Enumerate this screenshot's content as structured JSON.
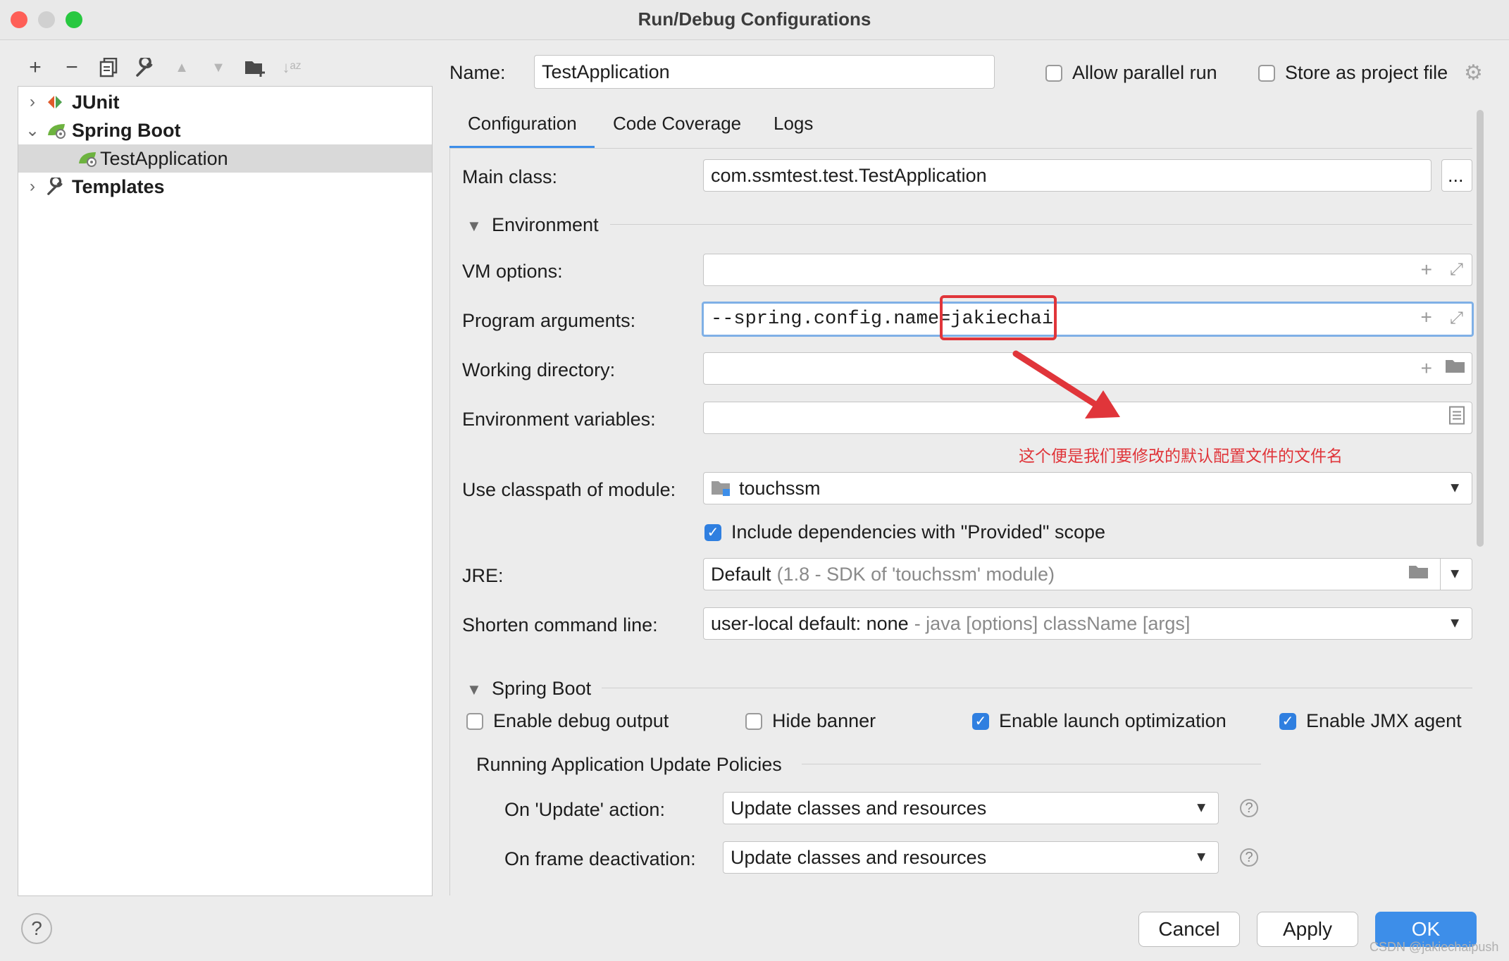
{
  "window": {
    "title": "Run/Debug Configurations"
  },
  "toolbar": {
    "icons": [
      "plus-icon",
      "minus-icon",
      "copy-icon",
      "wrench-icon",
      "arrow-up-icon",
      "arrow-down-icon",
      "new-folder-icon",
      "sort-icon"
    ]
  },
  "tree": {
    "items": [
      {
        "label": "JUnit"
      },
      {
        "label": "Spring Boot"
      },
      {
        "label": "TestApplication"
      },
      {
        "label": "Templates"
      }
    ]
  },
  "header": {
    "name_label": "Name:",
    "name_value": "TestApplication",
    "allow_parallel_label": "Allow parallel run",
    "store_as_project_label": "Store as project file"
  },
  "tabs": [
    {
      "label": "Configuration"
    },
    {
      "label": "Code Coverage"
    },
    {
      "label": "Logs"
    }
  ],
  "form": {
    "main_class_label": "Main class:",
    "main_class_value": "com.ssmtest.test.TestApplication",
    "browse_label": "...",
    "environment_section": "Environment",
    "vm_options_label": "VM options:",
    "program_args_label": "Program arguments:",
    "program_args_value": "--spring.config.name=jakiechai",
    "working_dir_label": "Working directory:",
    "env_vars_label": "Environment variables:",
    "annotation": "这个便是我们要修改的默认配置文件的文件名",
    "classpath_label": "Use classpath of module:",
    "classpath_value": "touchssm",
    "include_deps_label": "Include dependencies with \"Provided\" scope",
    "jre_label": "JRE:",
    "jre_value": "Default",
    "jre_hint": "(1.8 - SDK of 'touchssm' module)",
    "shorten_label": "Shorten command line:",
    "shorten_value": "user-local default: none",
    "shorten_hint": "- java [options] className [args]"
  },
  "spring_boot": {
    "section": "Spring Boot",
    "debug_output_label": "Enable debug output",
    "hide_banner_label": "Hide banner",
    "launch_opt_label": "Enable launch optimization",
    "jmx_label": "Enable JMX agent",
    "policies_label": "Running Application Update Policies",
    "on_update_label": "On 'Update' action:",
    "on_update_value": "Update classes and resources",
    "on_frame_label": "On frame deactivation:",
    "on_frame_value": "Update classes and resources"
  },
  "footer": {
    "help": "?",
    "cancel": "Cancel",
    "apply": "Apply",
    "ok": "OK"
  },
  "watermark": "CSDN @jakiechaipush",
  "colors": {
    "accent": "#3d8ee9",
    "highlight_box": "#e0353a",
    "annotation": "#e0353a"
  }
}
